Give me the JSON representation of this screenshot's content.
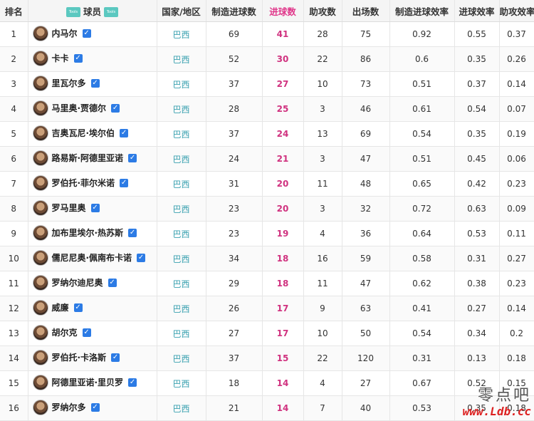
{
  "headers": {
    "rank": "排名",
    "player": "球员",
    "country": "国家/地区",
    "created_goals": "制造进球数",
    "goals": "进球数",
    "assists": "助攻数",
    "appearances": "出场数",
    "created_rate": "制造进球效率",
    "goal_rate": "进球效率",
    "assist_rate": "助攻效率"
  },
  "rows": [
    {
      "rank": "1",
      "name": "内马尔",
      "country": "巴西",
      "created": "69",
      "goals": "41",
      "assists": "28",
      "apps": "75",
      "created_rate": "0.92",
      "goal_rate": "0.55",
      "assist_rate": "0.37"
    },
    {
      "rank": "2",
      "name": "卡卡",
      "country": "巴西",
      "created": "52",
      "goals": "30",
      "assists": "22",
      "apps": "86",
      "created_rate": "0.6",
      "goal_rate": "0.35",
      "assist_rate": "0.26"
    },
    {
      "rank": "3",
      "name": "里瓦尔多",
      "country": "巴西",
      "created": "37",
      "goals": "27",
      "assists": "10",
      "apps": "73",
      "created_rate": "0.51",
      "goal_rate": "0.37",
      "assist_rate": "0.14"
    },
    {
      "rank": "4",
      "name": "马里奥·贾德尔",
      "country": "巴西",
      "created": "28",
      "goals": "25",
      "assists": "3",
      "apps": "46",
      "created_rate": "0.61",
      "goal_rate": "0.54",
      "assist_rate": "0.07"
    },
    {
      "rank": "5",
      "name": "吉奥瓦尼·埃尔伯",
      "country": "巴西",
      "created": "37",
      "goals": "24",
      "assists": "13",
      "apps": "69",
      "created_rate": "0.54",
      "goal_rate": "0.35",
      "assist_rate": "0.19"
    },
    {
      "rank": "6",
      "name": "路易斯·阿德里亚诺",
      "country": "巴西",
      "created": "24",
      "goals": "21",
      "assists": "3",
      "apps": "47",
      "created_rate": "0.51",
      "goal_rate": "0.45",
      "assist_rate": "0.06"
    },
    {
      "rank": "7",
      "name": "罗伯托·菲尔米诺",
      "country": "巴西",
      "created": "31",
      "goals": "20",
      "assists": "11",
      "apps": "48",
      "created_rate": "0.65",
      "goal_rate": "0.42",
      "assist_rate": "0.23"
    },
    {
      "rank": "8",
      "name": "罗马里奥",
      "country": "巴西",
      "created": "23",
      "goals": "20",
      "assists": "3",
      "apps": "32",
      "created_rate": "0.72",
      "goal_rate": "0.63",
      "assist_rate": "0.09"
    },
    {
      "rank": "9",
      "name": "加布里埃尔·热苏斯",
      "country": "巴西",
      "created": "23",
      "goals": "19",
      "assists": "4",
      "apps": "36",
      "created_rate": "0.64",
      "goal_rate": "0.53",
      "assist_rate": "0.11"
    },
    {
      "rank": "10",
      "name": "儒尼尼奥·佩南布卡诺",
      "country": "巴西",
      "created": "34",
      "goals": "18",
      "assists": "16",
      "apps": "59",
      "created_rate": "0.58",
      "goal_rate": "0.31",
      "assist_rate": "0.27"
    },
    {
      "rank": "11",
      "name": "罗纳尔迪尼奥",
      "country": "巴西",
      "created": "29",
      "goals": "18",
      "assists": "11",
      "apps": "47",
      "created_rate": "0.62",
      "goal_rate": "0.38",
      "assist_rate": "0.23"
    },
    {
      "rank": "12",
      "name": "威廉",
      "country": "巴西",
      "created": "26",
      "goals": "17",
      "assists": "9",
      "apps": "63",
      "created_rate": "0.41",
      "goal_rate": "0.27",
      "assist_rate": "0.14"
    },
    {
      "rank": "13",
      "name": "胡尔克",
      "country": "巴西",
      "created": "27",
      "goals": "17",
      "assists": "10",
      "apps": "50",
      "created_rate": "0.54",
      "goal_rate": "0.34",
      "assist_rate": "0.2"
    },
    {
      "rank": "14",
      "name": "罗伯托·卡洛斯",
      "country": "巴西",
      "created": "37",
      "goals": "15",
      "assists": "22",
      "apps": "120",
      "created_rate": "0.31",
      "goal_rate": "0.13",
      "assist_rate": "0.18"
    },
    {
      "rank": "15",
      "name": "阿德里亚诺·里贝罗",
      "country": "巴西",
      "created": "18",
      "goals": "14",
      "assists": "4",
      "apps": "27",
      "created_rate": "0.67",
      "goal_rate": "0.52",
      "assist_rate": "0.15"
    },
    {
      "rank": "16",
      "name": "罗纳尔多",
      "country": "巴西",
      "created": "21",
      "goals": "14",
      "assists": "7",
      "apps": "40",
      "created_rate": "0.53",
      "goal_rate": "0.35",
      "assist_rate": "0.18"
    }
  ],
  "watermark": {
    "cn": "零点吧",
    "url": "www.Ldb.cc"
  },
  "colors": {
    "goals": "#d0327f",
    "country": "#3aa1b0",
    "check": "#2c7be5",
    "header_bg": "#f5f5f5"
  }
}
